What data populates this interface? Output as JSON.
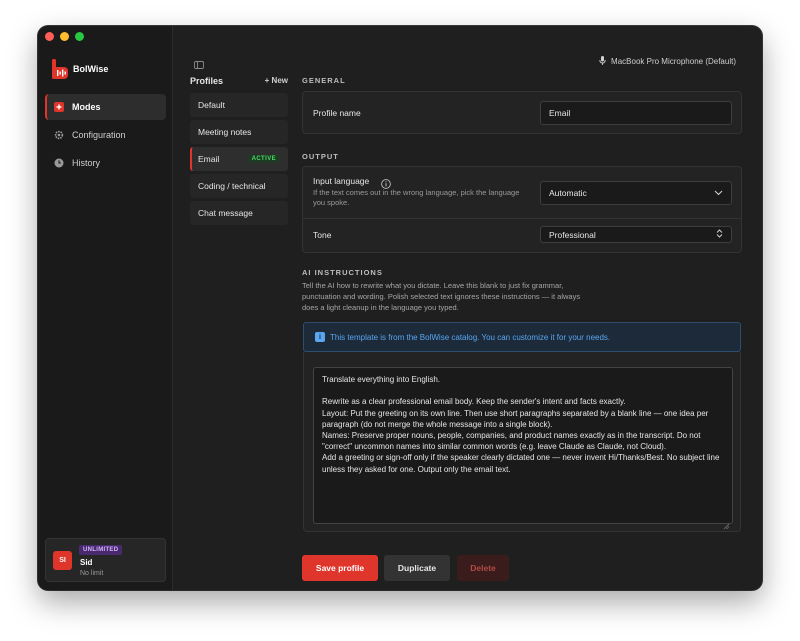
{
  "app": {
    "name": "BolWise"
  },
  "nav": {
    "items": [
      {
        "label": "Modes",
        "icon": "modes-icon",
        "active": true
      },
      {
        "label": "Configuration",
        "icon": "gear-icon",
        "active": false
      },
      {
        "label": "History",
        "icon": "clock-icon",
        "active": false
      }
    ]
  },
  "user": {
    "initials": "SI",
    "plan": "UNLIMITED",
    "name": "Sid",
    "limit": "No limit"
  },
  "header": {
    "microphone": "MacBook Pro Microphone (Default)"
  },
  "profiles": {
    "title": "Profiles",
    "new_label": "+ New",
    "items": [
      {
        "label": "Default"
      },
      {
        "label": "Meeting notes"
      },
      {
        "label": "Email",
        "badge": "ACTIVE"
      },
      {
        "label": "Coding / technical"
      },
      {
        "label": "Chat message"
      }
    ]
  },
  "general": {
    "section": "GENERAL",
    "profile_name_label": "Profile name",
    "profile_name_value": "Email"
  },
  "output": {
    "section": "OUTPUT",
    "input_language_label": "Input language",
    "input_language_help": "If the text comes out in the wrong language, pick the language you spoke.",
    "input_language_value": "Automatic",
    "tone_label": "Tone",
    "tone_value": "Professional"
  },
  "ai": {
    "section": "AI INSTRUCTIONS",
    "description": "Tell the AI how to rewrite what you dictate. Leave this blank to just fix grammar, punctuation and wording. Polish selected text ignores these instructions — it always does a light cleanup in the language you typed.",
    "banner": "This template is from the BolWise catalog. You can customize it for your needs.",
    "instructions": "Translate everything into English.\n\nRewrite as a clear professional email body. Keep the sender's intent and facts exactly.\nLayout: Put the greeting on its own line. Then use short paragraphs separated by a blank line — one idea per paragraph (do not merge the whole message into a single block).\nNames: Preserve proper nouns, people, companies, and product names exactly as in the transcript. Do not \"correct\" uncommon names into similar common words (e.g. leave Claude as Claude, not Cloud).\nAdd a greeting or sign-off only if the speaker clearly dictated one — never invent Hi/Thanks/Best. No subject line unless they asked for one. Output only the email text."
  },
  "actions": {
    "save": "Save profile",
    "duplicate": "Duplicate",
    "delete": "Delete"
  },
  "colors": {
    "accent": "#e0352b",
    "active_badge": "#4cd964",
    "info": "#5aa6f0",
    "plan_badge": "#d3b4ff"
  }
}
